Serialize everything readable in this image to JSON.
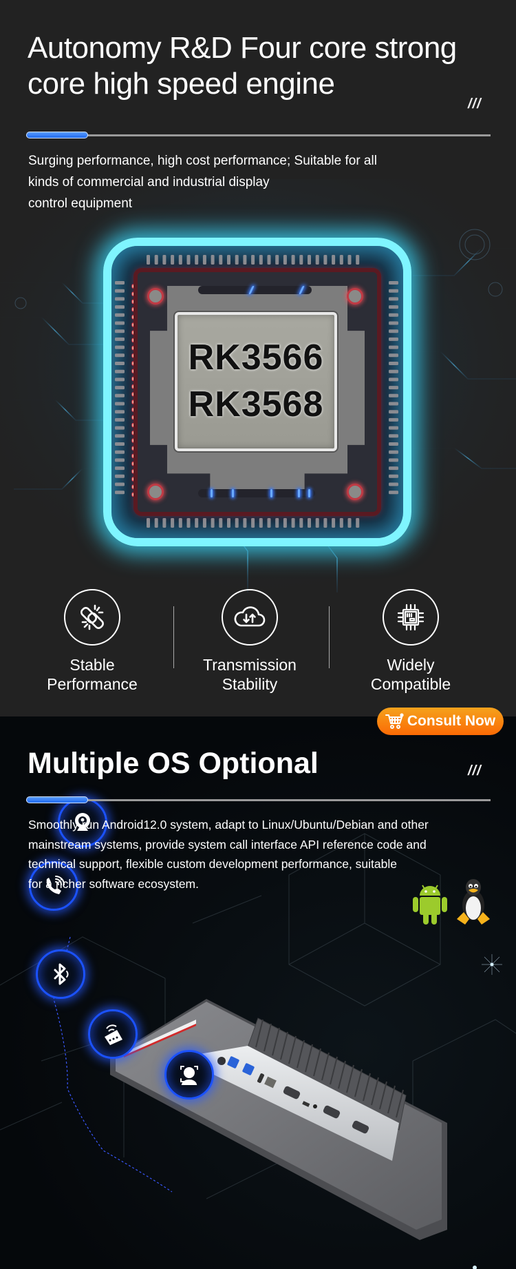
{
  "section_performance": {
    "title": "Autonomy R&D Four core strong core high speed engine",
    "decoration": "///",
    "description": "Surging performance, high cost performance; Suitable for all kinds of commercial and industrial display control equipment",
    "description_lines": [
      "Surging performance, high cost performance; Suitable for all",
      "kinds of commercial and industrial display",
      "control equipment"
    ],
    "chip": {
      "models": [
        "RK3566",
        "RK3568"
      ],
      "glow_color": "#7ff5ff",
      "pin_color": "#e8434f"
    },
    "features": [
      {
        "icon": "broken-link-icon",
        "label_line1": "Stable",
        "label_line2": "Performance"
      },
      {
        "icon": "cloud-sync-icon",
        "label_line1": "Transmission",
        "label_line2": "Stability"
      },
      {
        "icon": "chip-icon",
        "label_line1": "Widely",
        "label_line2": "Compatible"
      }
    ],
    "consult_button": {
      "label": "Consult Now",
      "icon": "shopping-cart-icon"
    }
  },
  "section_os": {
    "title": "Multiple OS Optional",
    "decoration": "///",
    "description_lines": [
      "Smoothly run Android12.0 system, adapt to Linux/Ubuntu/Debian and other",
      "mainstream systems, provide system call interface API reference code and",
      "technical support, flexible custom development performance, suitable",
      "for a richer software ecosystem."
    ],
    "os_logos": [
      "android-logo-icon",
      "linux-tux-icon"
    ],
    "connectivity_icons": [
      "webcam-icon",
      "phone-call-icon",
      "bluetooth-icon",
      "wifi-router-icon",
      "face-recognition-icon"
    ],
    "product_image": "panel-pc-rear-io-ports"
  },
  "colors": {
    "accent_blue": "#1f6bf0",
    "consult_orange": "#fb6a05",
    "background_dark": "#222222",
    "background_black": "#05080b"
  }
}
